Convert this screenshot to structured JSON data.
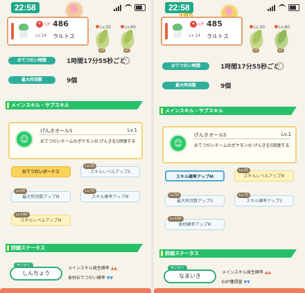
{
  "panels": [
    {
      "status": {
        "time": "22:58",
        "subheading": ""
      },
      "helper": {
        "cp_value": "486",
        "level": "Lv.14",
        "name": "ラルトス"
      },
      "tiles": [
        {
          "level": "Lv.30",
          "count": "x3"
        },
        {
          "level": "Lv.60",
          "count": "x1"
        }
      ],
      "interval": {
        "label": "おてつだい時間",
        "value": "1時間17分55秒ごと"
      },
      "capacity": {
        "label": "最大所持数",
        "value": "9個"
      },
      "section_skill": "メインスキル・サブスキル",
      "main_skill": {
        "name": "げんきオールS",
        "level": "Lv.1",
        "description": "おてつだいチームのポケモンの げんきを5回復する"
      },
      "subskills": [
        {
          "level": "",
          "label": "おてつだいボーナス",
          "style": "gold"
        },
        {
          "level": "Lv.25",
          "label": "スキルレベルアップS",
          "style": "blue"
        },
        {
          "level": "Lv.50",
          "label": "最大所持数アップM",
          "style": "blue"
        },
        {
          "level": "Lv.75",
          "label": "スキル確率アップM",
          "style": "blue"
        },
        {
          "level": "Lv.100",
          "label": "スキルレベルアップM",
          "style": "yel"
        }
      ],
      "section_details": "詳細ステータス",
      "nature": {
        "tag": "せいかく",
        "value": "しんちょう"
      },
      "effects": [
        {
          "label": "メインスキル発生確率",
          "marks": "▲▲",
          "dir": "up"
        },
        {
          "label": "食材おてつだい確率",
          "marks": "▼▼",
          "dir": "down"
        }
      ]
    },
    {
      "status": {
        "time": "22:58",
        "subheading": "手持ち"
      },
      "helper": {
        "cp_value": "485",
        "level": "Lv.14",
        "name": "ラルトス"
      },
      "tiles": [
        {
          "level": "Lv.30",
          "count": "x1"
        },
        {
          "level": "Lv.60",
          "count": "x1"
        }
      ],
      "interval": {
        "label": "おてつだい時間",
        "value": "1時間17分55秒ごと"
      },
      "capacity": {
        "label": "最大所持数",
        "value": "9個"
      },
      "section_skill": "メインスキル・サブスキル",
      "main_skill": {
        "name": "げんきオールS",
        "level": "Lv.1",
        "description": "おてつだいチームのポケモンの げんきを5回復する"
      },
      "subskills": [
        {
          "level": "",
          "label": "スキル確率アップM",
          "style": "sel"
        },
        {
          "level": "Lv.25",
          "label": "スキルレベルアップM",
          "style": "yel"
        },
        {
          "level": "Lv.50",
          "label": "最大所持数アップS",
          "style": "blue"
        },
        {
          "level": "Lv.75",
          "label": "スキル確率アップS",
          "style": "blue"
        },
        {
          "level": "Lv.100",
          "label": "食材確率アップM",
          "style": "blue"
        }
      ],
      "section_details": "詳細ステータス",
      "nature": {
        "tag": "せいかく",
        "value": "なまいき"
      },
      "effects": [
        {
          "label": "メインスキル発生確率",
          "marks": "▲▲",
          "dir": "up"
        },
        {
          "label": "EXP獲得量",
          "marks": "▼▼",
          "dir": "down"
        }
      ]
    }
  ],
  "colors": {
    "accent_green": "#27c06a",
    "teal": "#2fae9a",
    "gold": "#fbd25a",
    "cp_red": "#e24b3b"
  },
  "icons": {
    "main_skill": "smiley-face-icon",
    "info": "info-icon",
    "cp": "cp-icon"
  }
}
